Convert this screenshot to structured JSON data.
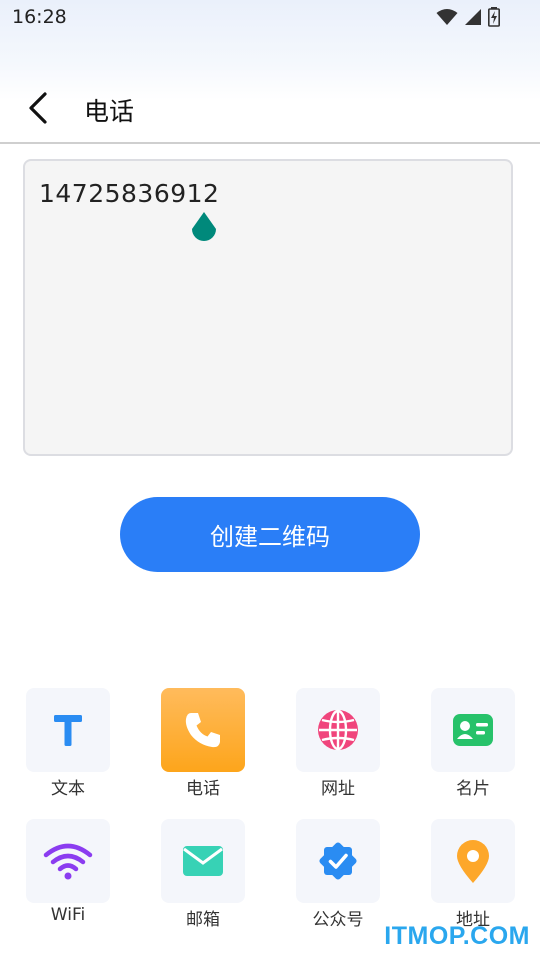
{
  "status_bar": {
    "time": "16:28"
  },
  "header": {
    "title": "电话"
  },
  "input": {
    "value": "14725836912"
  },
  "create_button": {
    "label": "创建二维码"
  },
  "types": [
    {
      "label": "文本",
      "icon": "text-icon",
      "selected": false
    },
    {
      "label": "电话",
      "icon": "phone-icon",
      "selected": true
    },
    {
      "label": "网址",
      "icon": "globe-icon",
      "selected": false
    },
    {
      "label": "名片",
      "icon": "business-card-icon",
      "selected": false
    },
    {
      "label": "WiFi",
      "icon": "wifi-icon",
      "selected": false
    },
    {
      "label": "邮箱",
      "icon": "mail-icon",
      "selected": false
    },
    {
      "label": "公众号",
      "icon": "verified-badge-icon",
      "selected": false
    },
    {
      "label": "地址",
      "icon": "location-pin-icon",
      "selected": false
    }
  ],
  "watermark": {
    "text": "ITMOP.COM"
  },
  "colors": {
    "primary": "#2a7ef7",
    "selected_tile": "#fda51b",
    "handle": "#00897b",
    "watermark": "#2aa7ee"
  }
}
